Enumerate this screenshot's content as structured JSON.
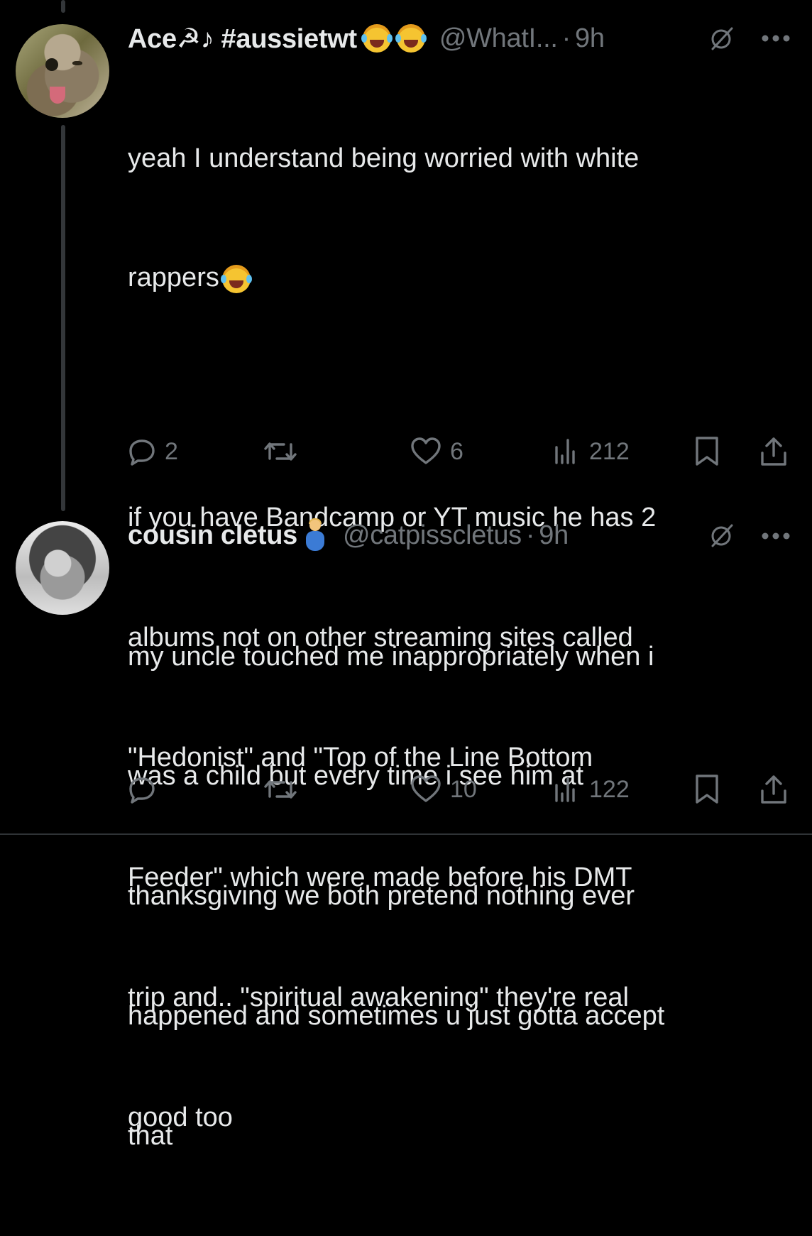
{
  "theme": {
    "background": "#000000",
    "text": "#e7e9ea",
    "muted": "#71767b",
    "thread_line": "#333639"
  },
  "tweets": [
    {
      "display_name": "Ace☭♪ #aussietwt",
      "name_emojis": [
        "joy-cat-emoji",
        "joy-cat-emoji"
      ],
      "handle": "@WhatI...",
      "separator": "·",
      "time": "9h",
      "avatar": "cat-avatar",
      "lines": [
        "yeah I understand being worried with white",
        "rappers",
        "",
        "if you have Bandcamp or YT music he has 2",
        "albums not on other streaming sites called",
        "\"Hedonist\" and \"Top of the Line Bottom",
        "Feeder\" which were made before his DMT",
        "trip and.. \"spiritual awakening\" they're real",
        "good too"
      ],
      "replies": "2",
      "reposts": "",
      "likes": "6",
      "views": "212"
    },
    {
      "display_name": "cousin cletus",
      "name_emojis": [
        "pregnant-man-emoji"
      ],
      "handle": "@catpisscletus",
      "separator": "·",
      "time": "9h",
      "avatar": "monkey-avatar",
      "lines": [
        "my uncle touched me inappropriately when i",
        "was a child but every time i see him at",
        "thanksgiving we both pretend nothing ever",
        "happened and sometimes u just gotta accept",
        "that"
      ],
      "replies": "",
      "reposts": "",
      "likes": "10",
      "views": "122"
    }
  ]
}
